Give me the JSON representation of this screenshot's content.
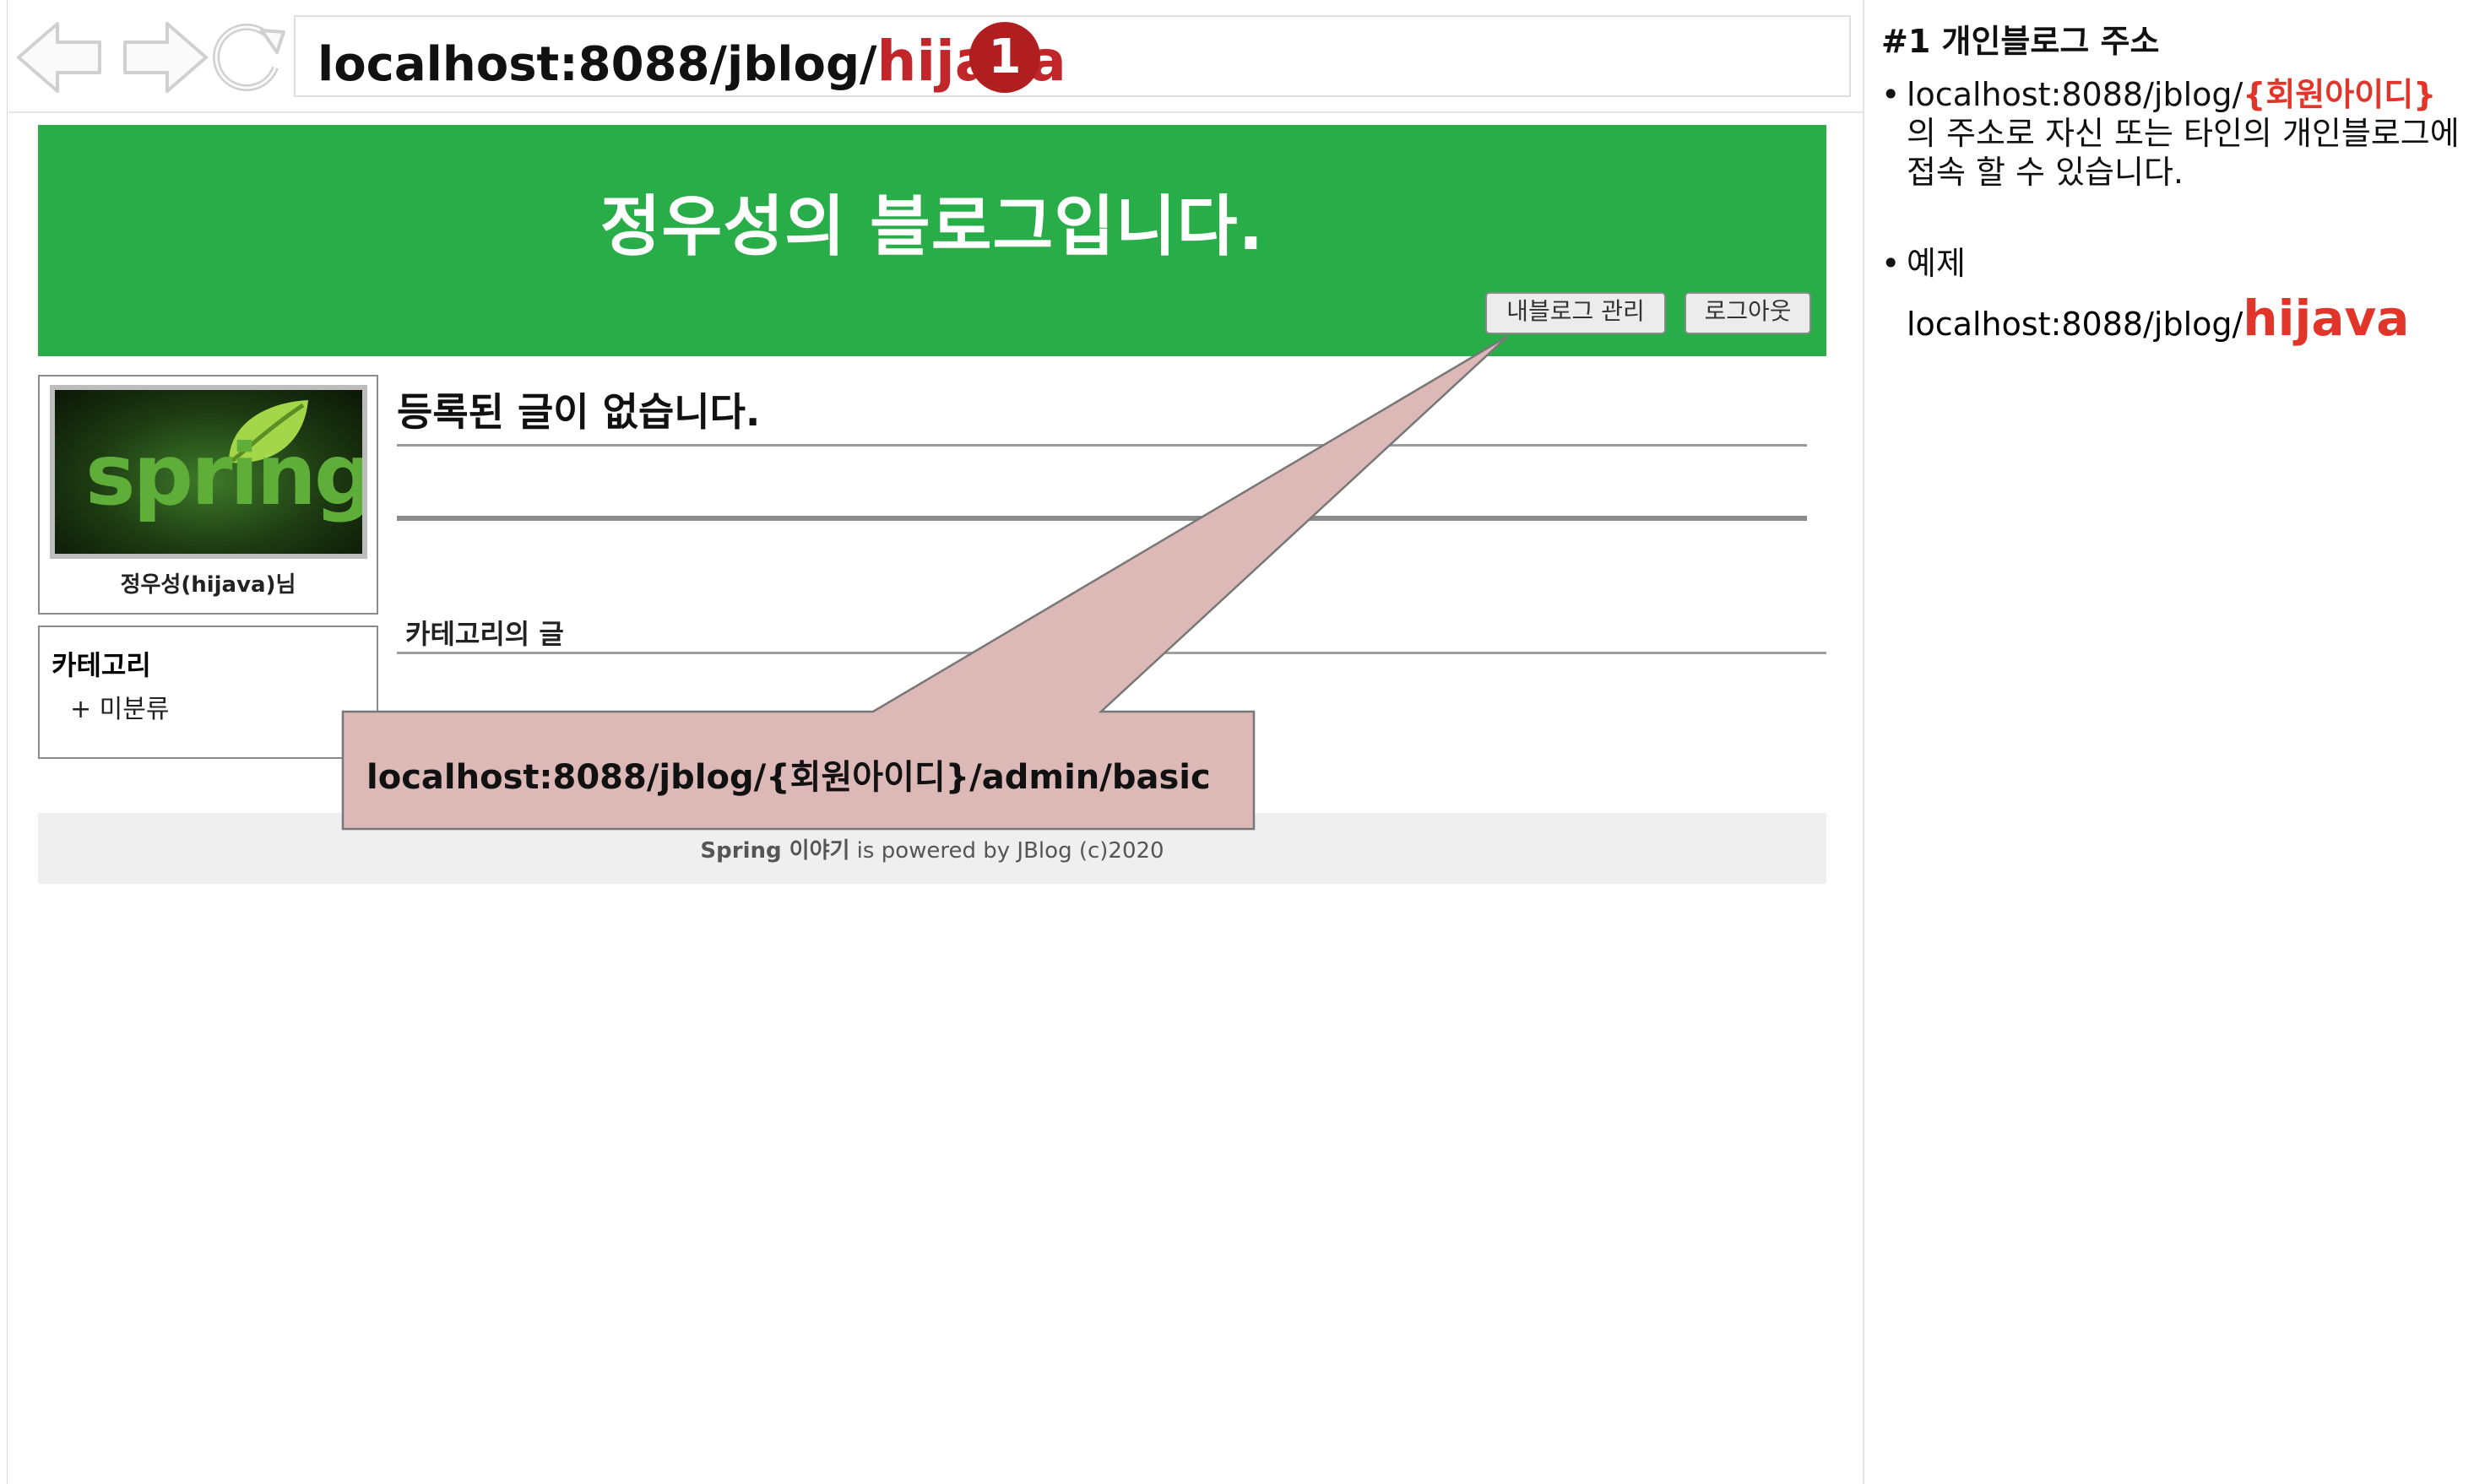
{
  "browser": {
    "url_base": "localhost:8088/jblog/",
    "url_user": "hijava",
    "step_badge": "1"
  },
  "blog": {
    "title": "정우성의 블로그입니다.",
    "admin_button": "내블로그 관리",
    "logout_button": "로그아웃",
    "profile_image_text": "spring",
    "profile_name": "정우성(hijava)님",
    "category_title": "카테고리",
    "category_items": [
      "+ 미분류"
    ],
    "post_title": "등록된 글이 없습니다.",
    "category_posts_label": "카테고리의 글",
    "footer_brand": "Spring 이야기",
    "footer_rest": " is powered by JBlog (c)2020"
  },
  "callout": {
    "text": "localhost:8088/jblog/{회원아이디}/admin/basic"
  },
  "notes": {
    "heading": "#1 개인블로그 주소",
    "bullet1_prefix": "localhost:8088/jblog/",
    "bullet1_highlight": "{회원아이디}",
    "bullet1_suffix": " 의 주소로 자신 또는 타인의 개인블로그에 접속 할 수 있습니다.",
    "bullet2_label": "예제",
    "example_base": "localhost:8088/jblog/",
    "example_user": "hijava"
  },
  "colors": {
    "header_green": "#28ad48",
    "badge_red": "#b01e1f",
    "highlight_red": "#e2352a",
    "callout_fill": "#dcb8b7"
  }
}
